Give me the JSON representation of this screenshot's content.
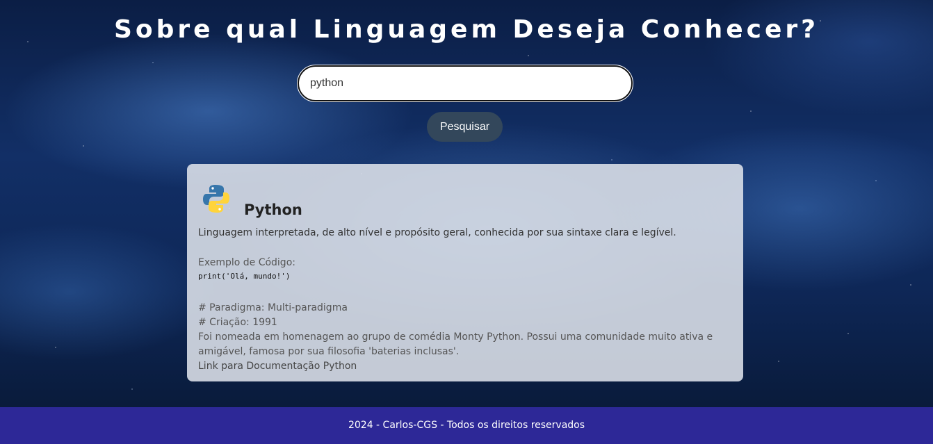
{
  "page": {
    "title": "Sobre qual Linguagem Deseja Conhecer?"
  },
  "search": {
    "value": "python",
    "button_label": "Pesquisar"
  },
  "result": {
    "language_name": "Python",
    "logo_icon": "python-logo-icon",
    "description": "Linguagem interpretada, de alto nível e propósito geral, conhecida por sua sintaxe clara e legível.",
    "code_label": "Exemplo de Código:",
    "code_example": "print('Olá, mundo!')",
    "paradigm": "# Paradigma: Multi-paradigma",
    "creation": "# Criação: 1991",
    "trivia": "Foi nomeada em homenagem ao grupo de comédia Monty Python. Possui uma comunidade muito ativa e amigável, famosa por sua filosofia 'baterias inclusas'.",
    "doc_link_text": "Link para Documentação Python"
  },
  "footer": {
    "text": "2024 - Carlos-CGS - Todos os direitos reservados"
  },
  "colors": {
    "footer_bg": "#2d2897",
    "button_bg": "#33475b",
    "python_blue": "#3776ab",
    "python_yellow": "#ffd43b"
  }
}
